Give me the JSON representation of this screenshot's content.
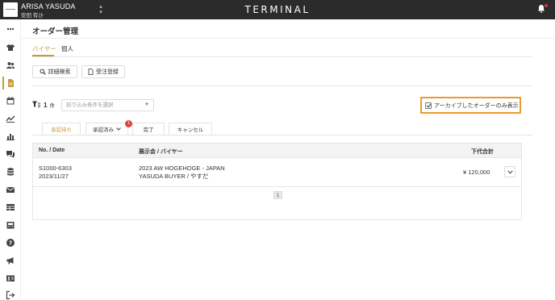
{
  "topbar": {
    "user_name": "ARISA YASUDA",
    "user_sub": "安田 有沙",
    "brand": "TERMINAL"
  },
  "sidebar": {
    "items": [
      {
        "icon": "grid-icon"
      },
      {
        "icon": "tshirt-icon"
      },
      {
        "icon": "users-icon"
      },
      {
        "icon": "document-icon",
        "active": true
      },
      {
        "icon": "calendar-icon"
      },
      {
        "icon": "trend-chart-icon"
      },
      {
        "icon": "bar-chart-icon"
      },
      {
        "icon": "chat-icon"
      },
      {
        "icon": "database-icon"
      },
      {
        "icon": "mail-icon"
      },
      {
        "icon": "table-icon"
      },
      {
        "icon": "archive-icon"
      },
      {
        "icon": "help-icon"
      },
      {
        "icon": "megaphone-icon"
      },
      {
        "icon": "id-card-icon"
      },
      {
        "icon": "logout-icon"
      }
    ]
  },
  "main": {
    "title": "オーダー管理",
    "tabs": [
      {
        "label": "バイヤー",
        "active": true
      },
      {
        "label": "個人",
        "active": false
      }
    ],
    "buttons": {
      "detail_search": "詳細検索",
      "order_register": "受注登録"
    },
    "filter": {
      "count": "1",
      "count_unit": "件",
      "select_placeholder": "絞り込み条件を選択"
    },
    "archive_checkbox": {
      "label": "アーカイブしたオーダーのみ表示",
      "checked": true
    },
    "status_tabs": [
      {
        "label": "承認待ち",
        "active": true
      },
      {
        "label": "承認済み",
        "has_dropdown": true,
        "badge": "1"
      },
      {
        "label": "完了"
      },
      {
        "label": "キャンセル"
      }
    ],
    "table": {
      "headers": {
        "no_date": "No. / Date",
        "exhibition_buyer": "展示会 / バイヤー",
        "total": "下代合計"
      },
      "rows": [
        {
          "no": "S1000-6303",
          "date": "2023/11/27",
          "exhibition": "2023 AW HOGEHOGE - JAPAN",
          "buyer": "YASUDA BUYER / やすだ",
          "total": "¥ 120,000"
        }
      ],
      "page": "1"
    }
  },
  "colors": {
    "accent": "#c99a3a",
    "highlight": "#ec9a2b",
    "topbar": "#2b2b2b",
    "badge": "#d64545"
  }
}
